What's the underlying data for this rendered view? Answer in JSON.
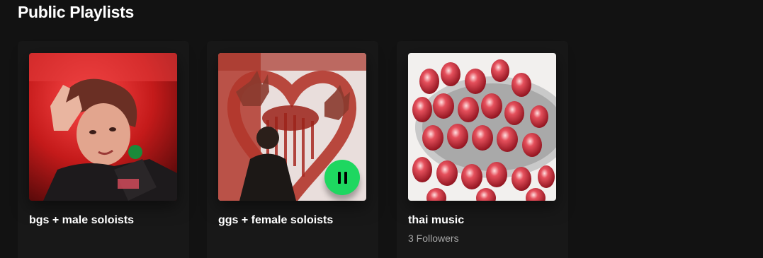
{
  "section": {
    "title": "Public Playlists"
  },
  "playlists": [
    {
      "title": "bgs + male soloists",
      "subtitle": "",
      "cover": "red-tinted-portrait-image"
    },
    {
      "title": "ggs + female soloists",
      "subtitle": "",
      "cover": "red-heart-painted-image",
      "playing": true,
      "play_button_icon": "pause-icon"
    },
    {
      "title": "thai music",
      "subtitle": "3 Followers",
      "cover": "pomegranate-seeds-image"
    }
  ],
  "colors": {
    "background": "#121212",
    "card": "#181818",
    "accent": "#1ed760",
    "subtext": "#a7a7a7"
  }
}
